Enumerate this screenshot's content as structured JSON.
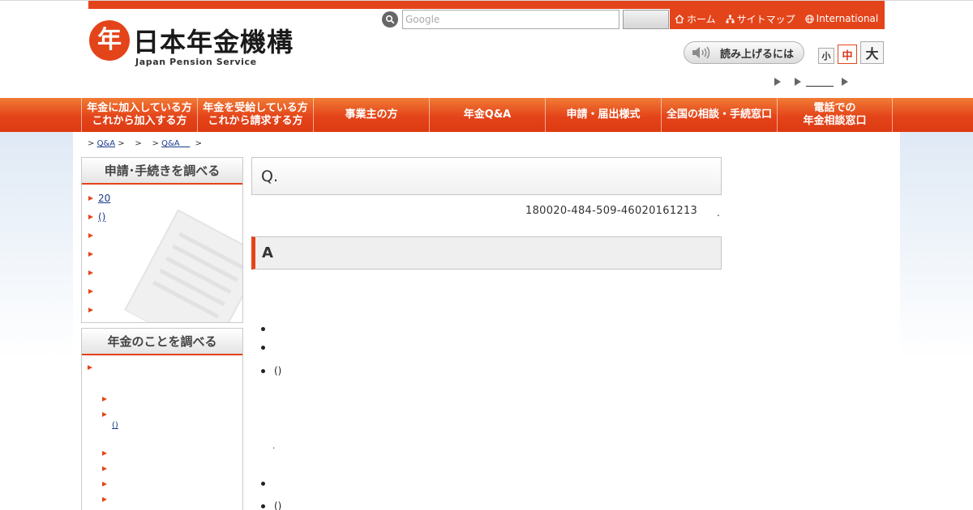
{
  "header": {
    "logo_mark": "年",
    "logo_name": "日本年金機構",
    "logo_subtitle": "Japan Pension Service",
    "search": {
      "placeholder": "Google",
      "button_label": ""
    },
    "links": [
      {
        "label": "ホーム",
        "icon": "home-icon"
      },
      {
        "label": "サイトマップ",
        "icon": "sitemap-icon"
      },
      {
        "label": "International",
        "icon": "globe-icon"
      }
    ],
    "readaloud_label": "読み上げるには",
    "font_size": {
      "small": "小",
      "medium": "中",
      "large": "大"
    }
  },
  "nav": {
    "items": [
      "年金に加入している方\nこれから加入する方",
      "年金を受給している方\nこれから請求する方",
      "事業主の方",
      "年金Q&A",
      "申請・届出様式",
      "全国の相談・手続窓口",
      "電話での\n年金相談窓口"
    ]
  },
  "breadcrumb": {
    "sep": ">",
    "qa_link_1": "Q&A",
    "qa_link_2": "Q&A"
  },
  "sidebar": {
    "box1": {
      "heading": "申請･手続きを調べる",
      "items": [
        "20",
        "()",
        "",
        "",
        "",
        "",
        ""
      ]
    },
    "box2": {
      "heading": "年金のことを調べる",
      "sub_link": "()"
    }
  },
  "main": {
    "question_label": "Q.",
    "question_number": "180020-484-509-46020161213",
    "question_number_trail": ".",
    "answer_label": "A",
    "bullet_paren": "()",
    "small_dot": "."
  },
  "colors": {
    "accent": "#e4441a",
    "link": "#1a3a8a"
  }
}
